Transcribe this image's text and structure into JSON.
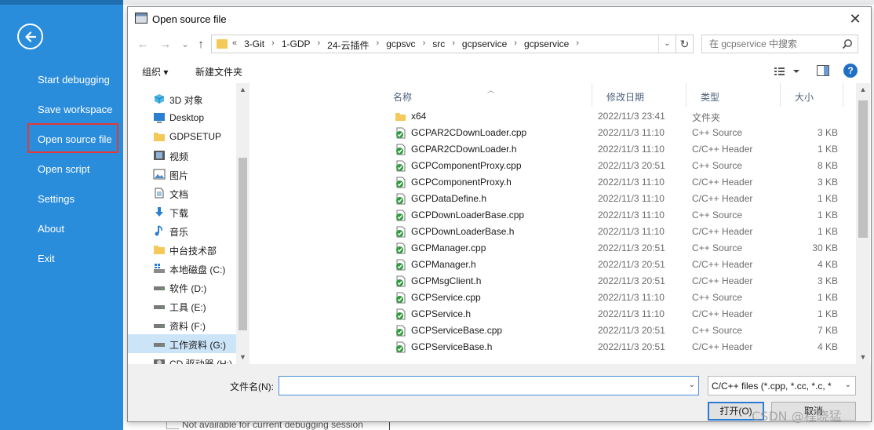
{
  "backstage": {
    "items": [
      {
        "label": "Start debugging"
      },
      {
        "label": "Save workspace"
      },
      {
        "label": "Open source file"
      },
      {
        "label": "Open script"
      },
      {
        "label": "Settings"
      },
      {
        "label": "About"
      },
      {
        "label": "Exit"
      }
    ],
    "background_text": "Not available for current debugging session"
  },
  "dialog": {
    "title": "Open source file",
    "close_glyph": "✕",
    "nav": {
      "back": "←",
      "forward": "→",
      "recent": "⌄",
      "up": "↑",
      "overflow": "«",
      "dropdown": "⌄",
      "refresh": "↻"
    },
    "breadcrumbs": [
      "3-Git",
      "1-GDP",
      "24-云插件",
      "gcpsvc",
      "src",
      "gcpservice",
      "gcpservice"
    ],
    "search": {
      "placeholder": "在 gcpservice 中搜索"
    },
    "toolbar": {
      "organize": "组织 ▾",
      "new_folder": "新建文件夹",
      "help": "?"
    },
    "navigation_pane": [
      {
        "label": "3D 对象",
        "icon": "3d-objects-icon"
      },
      {
        "label": "Desktop",
        "icon": "desktop-icon"
      },
      {
        "label": "GDPSETUP",
        "icon": "folder-icon"
      },
      {
        "label": "视频",
        "icon": "video-icon"
      },
      {
        "label": "图片",
        "icon": "pictures-icon"
      },
      {
        "label": "文档",
        "icon": "documents-icon"
      },
      {
        "label": "下载",
        "icon": "download-icon"
      },
      {
        "label": "音乐",
        "icon": "music-icon"
      },
      {
        "label": "中台技术部",
        "icon": "folder-icon"
      },
      {
        "label": "本地磁盘 (C:)",
        "icon": "windows-drive-icon"
      },
      {
        "label": "软件 (D:)",
        "icon": "drive-icon"
      },
      {
        "label": "工具 (E:)",
        "icon": "drive-icon"
      },
      {
        "label": "资料 (F:)",
        "icon": "drive-icon"
      },
      {
        "label": "工作资料 (G:)",
        "icon": "drive-icon",
        "selected": true
      },
      {
        "label": "CD 驱动器 (H:)",
        "icon": "cd-drive-icon"
      }
    ],
    "columns": {
      "name": "名称",
      "date": "修改日期",
      "type": "类型",
      "size": "大小"
    },
    "files": [
      {
        "name": "x64",
        "date": "2022/11/3 23:41",
        "type": "文件夹",
        "size": "",
        "kind": "folder"
      },
      {
        "name": "GCPAR2CDownLoader.cpp",
        "date": "2022/11/3 11:10",
        "type": "C++ Source",
        "size": "3 KB",
        "kind": "cpp"
      },
      {
        "name": "GCPAR2CDownLoader.h",
        "date": "2022/11/3 11:10",
        "type": "C/C++ Header",
        "size": "1 KB",
        "kind": "h"
      },
      {
        "name": "GCPComponentProxy.cpp",
        "date": "2022/11/3 20:51",
        "type": "C++ Source",
        "size": "8 KB",
        "kind": "cpp"
      },
      {
        "name": "GCPComponentProxy.h",
        "date": "2022/11/3 11:10",
        "type": "C/C++ Header",
        "size": "3 KB",
        "kind": "h"
      },
      {
        "name": "GCPDataDefine.h",
        "date": "2022/11/3 11:10",
        "type": "C/C++ Header",
        "size": "1 KB",
        "kind": "h"
      },
      {
        "name": "GCPDownLoaderBase.cpp",
        "date": "2022/11/3 11:10",
        "type": "C++ Source",
        "size": "1 KB",
        "kind": "cpp"
      },
      {
        "name": "GCPDownLoaderBase.h",
        "date": "2022/11/3 11:10",
        "type": "C/C++ Header",
        "size": "1 KB",
        "kind": "h"
      },
      {
        "name": "GCPManager.cpp",
        "date": "2022/11/3 20:51",
        "type": "C++ Source",
        "size": "30 KB",
        "kind": "cpp"
      },
      {
        "name": "GCPManager.h",
        "date": "2022/11/3 20:51",
        "type": "C/C++ Header",
        "size": "4 KB",
        "kind": "h"
      },
      {
        "name": "GCPMsgClient.h",
        "date": "2022/11/3 20:51",
        "type": "C/C++ Header",
        "size": "3 KB",
        "kind": "h"
      },
      {
        "name": "GCPService.cpp",
        "date": "2022/11/3 11:10",
        "type": "C++ Source",
        "size": "1 KB",
        "kind": "cpp"
      },
      {
        "name": "GCPService.h",
        "date": "2022/11/3 11:10",
        "type": "C/C++ Header",
        "size": "1 KB",
        "kind": "h"
      },
      {
        "name": "GCPServiceBase.cpp",
        "date": "2022/11/3 20:51",
        "type": "C++ Source",
        "size": "7 KB",
        "kind": "cpp"
      },
      {
        "name": "GCPServiceBase.h",
        "date": "2022/11/3 20:51",
        "type": "C/C++ Header",
        "size": "4 KB",
        "kind": "h"
      }
    ],
    "filename_label": "文件名(N):",
    "filename_value": "",
    "filter_value": "C/C++ files (*.cpp, *.cc, *.c, *",
    "open_label": "打开(O)",
    "cancel_label": "取消"
  },
  "watermark": "CSDN @程晓猛",
  "colors": {
    "backstage_blue": "#2a8ddc",
    "highlight_red": "#e53935",
    "selection_blue": "#cce4f7",
    "accent": "#2a7bd4"
  }
}
